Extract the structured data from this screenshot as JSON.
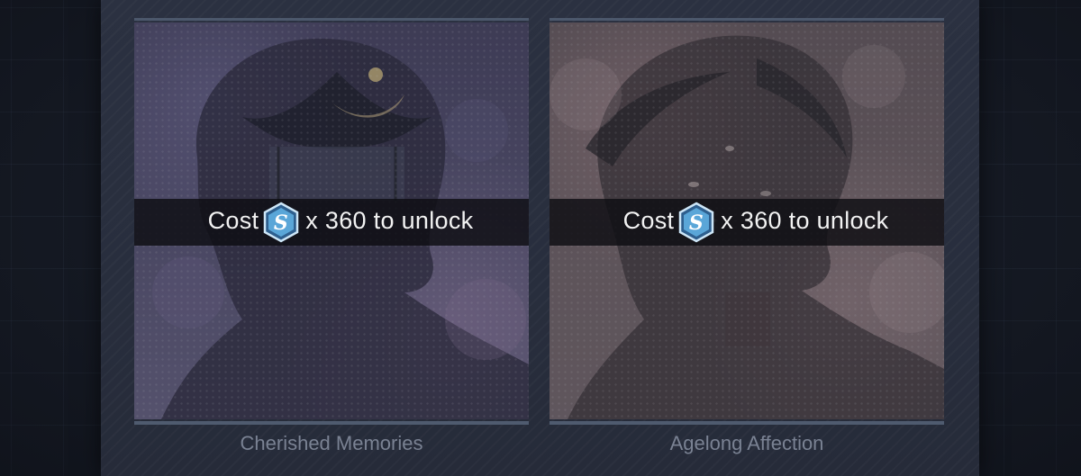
{
  "cards": [
    {
      "title": "Cherished Memories",
      "cost_prefix": "Cost",
      "cost_icon": "s-gem-icon",
      "cost_suffix": "x 360 to unlock",
      "locked": true
    },
    {
      "title": "Agelong Affection",
      "cost_prefix": "Cost",
      "cost_icon": "s-gem-icon",
      "cost_suffix": "x 360 to unlock",
      "locked": true
    }
  ],
  "colors": {
    "background": "#181d28",
    "panel": "#2b3141",
    "label": "#7a8293",
    "cost_text": "#f2f2f2",
    "gem": "#5aa6d8"
  }
}
